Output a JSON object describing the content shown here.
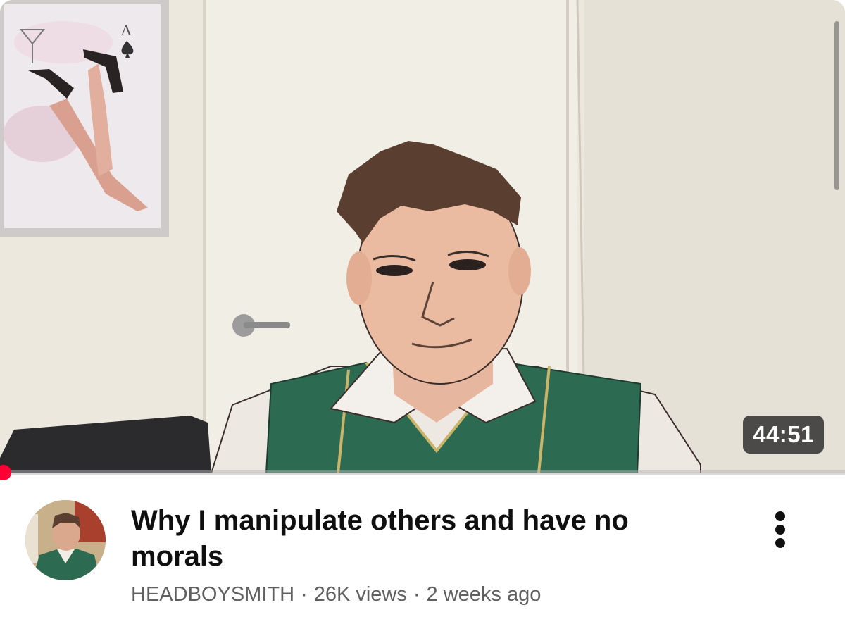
{
  "video": {
    "duration": "44:51",
    "title": "Why I manipulate others and have no morals",
    "channel": "HEADBOYSMITH",
    "views": "26K views",
    "age": "2 weeks ago",
    "separator": "·"
  },
  "icons": {
    "more": "more-vertical-icon"
  },
  "colors": {
    "progress": "#ff0033",
    "title": "#0f0f0f",
    "meta": "#606060",
    "vest": "#2d6a52"
  }
}
